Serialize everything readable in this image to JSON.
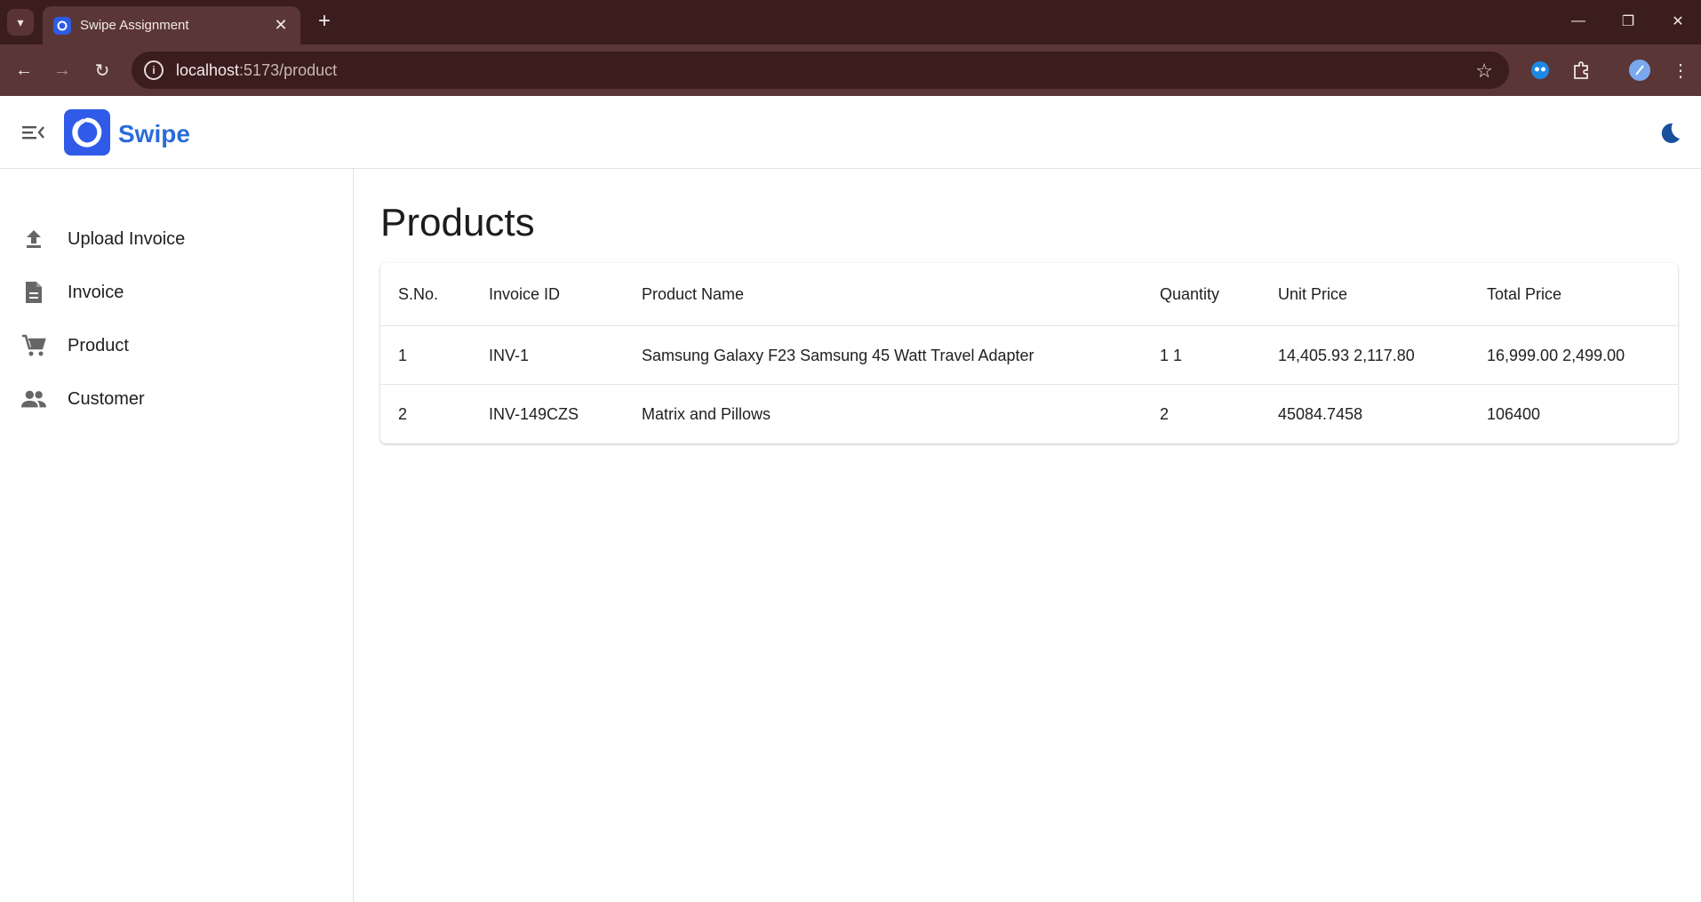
{
  "browser": {
    "tab_title": "Swipe Assignment",
    "url_host": "localhost",
    "url_path": ":5173/product"
  },
  "header": {
    "brand": "Swipe"
  },
  "sidebar": {
    "items": [
      {
        "label": "Upload Invoice",
        "icon": "upload-icon"
      },
      {
        "label": "Invoice",
        "icon": "document-icon"
      },
      {
        "label": "Product",
        "icon": "cart-icon"
      },
      {
        "label": "Customer",
        "icon": "people-icon"
      }
    ]
  },
  "main": {
    "title": "Products",
    "table": {
      "columns": [
        "S.No.",
        "Invoice ID",
        "Product Name",
        "Quantity",
        "Unit Price",
        "Total Price"
      ],
      "rows": [
        [
          "1",
          "INV-1",
          "Samsung Galaxy F23 Samsung 45 Watt Travel Adapter",
          "1 1",
          "14,405.93 2,117.80",
          "16,999.00 2,499.00"
        ],
        [
          "2",
          "INV-149CZS",
          "Matrix and Pillows",
          "2",
          "45084.7458",
          "106400"
        ]
      ]
    }
  },
  "colors": {
    "tabbar_bg": "#3b1d1d",
    "toolbar_bg": "#5b3636",
    "brand_blue": "#2a6bd8",
    "logo_bg": "#2f5be8"
  }
}
